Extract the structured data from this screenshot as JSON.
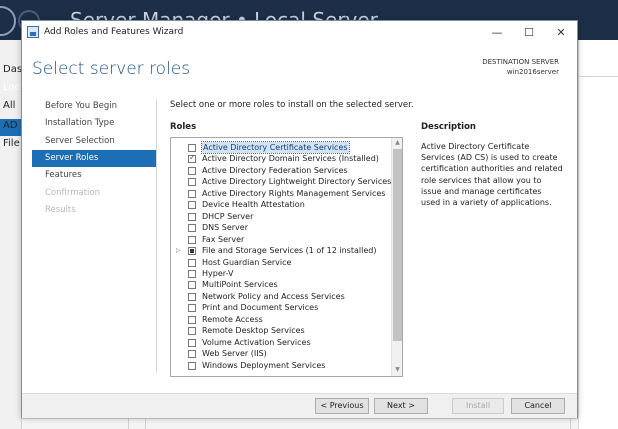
{
  "background": {
    "title": "Server Manager • Local Server",
    "nav_items": [
      "Das",
      "Loc",
      "All",
      "AD",
      "File"
    ]
  },
  "dialog": {
    "title": "Add Roles and Features Wizard",
    "window_buttons": {
      "minimize": "—",
      "maximize": "☐",
      "close": "✕"
    }
  },
  "header": {
    "page_title": "Select server roles",
    "destination_label": "DESTINATION SERVER",
    "destination_server": "win2016server"
  },
  "nav": {
    "items": [
      {
        "label": "Before You Begin",
        "state": "normal"
      },
      {
        "label": "Installation Type",
        "state": "normal"
      },
      {
        "label": "Server Selection",
        "state": "normal"
      },
      {
        "label": "Server Roles",
        "state": "selected"
      },
      {
        "label": "Features",
        "state": "normal"
      },
      {
        "label": "Confirmation",
        "state": "disabled"
      },
      {
        "label": "Results",
        "state": "disabled"
      }
    ]
  },
  "content": {
    "instruction": "Select one or more roles to install on the selected server.",
    "roles_label": "Roles",
    "description_label": "Description",
    "description_text": "Active Directory Certificate Services (AD CS) is used to create certification authorities and related role services that allow you to issue and manage certificates used in a variety of applications."
  },
  "roles": [
    {
      "label": "Active Directory Certificate Services",
      "state": "unchecked",
      "selected": true,
      "expander": false
    },
    {
      "label": "Active Directory Domain Services (Installed)",
      "state": "checked",
      "selected": false,
      "expander": false
    },
    {
      "label": "Active Directory Federation Services",
      "state": "unchecked",
      "selected": false,
      "expander": false
    },
    {
      "label": "Active Directory Lightweight Directory Services",
      "state": "unchecked",
      "selected": false,
      "expander": false
    },
    {
      "label": "Active Directory Rights Management Services",
      "state": "unchecked",
      "selected": false,
      "expander": false
    },
    {
      "label": "Device Health Attestation",
      "state": "unchecked",
      "selected": false,
      "expander": false
    },
    {
      "label": "DHCP Server",
      "state": "unchecked",
      "selected": false,
      "expander": false
    },
    {
      "label": "DNS Server",
      "state": "unchecked",
      "selected": false,
      "expander": false
    },
    {
      "label": "Fax Server",
      "state": "unchecked",
      "selected": false,
      "expander": false
    },
    {
      "label": "File and Storage Services (1 of 12 installed)",
      "state": "partial",
      "selected": false,
      "expander": true
    },
    {
      "label": "Host Guardian Service",
      "state": "unchecked",
      "selected": false,
      "expander": false
    },
    {
      "label": "Hyper-V",
      "state": "unchecked",
      "selected": false,
      "expander": false
    },
    {
      "label": "MultiPoint Services",
      "state": "unchecked",
      "selected": false,
      "expander": false
    },
    {
      "label": "Network Policy and Access Services",
      "state": "unchecked",
      "selected": false,
      "expander": false
    },
    {
      "label": "Print and Document Services",
      "state": "unchecked",
      "selected": false,
      "expander": false
    },
    {
      "label": "Remote Access",
      "state": "unchecked",
      "selected": false,
      "expander": false
    },
    {
      "label": "Remote Desktop Services",
      "state": "unchecked",
      "selected": false,
      "expander": false
    },
    {
      "label": "Volume Activation Services",
      "state": "unchecked",
      "selected": false,
      "expander": false
    },
    {
      "label": "Web Server (IIS)",
      "state": "unchecked",
      "selected": false,
      "expander": false
    },
    {
      "label": "Windows Deployment Services",
      "state": "unchecked",
      "selected": false,
      "expander": false
    }
  ],
  "footer": {
    "previous_label": "< Previous",
    "next_label": "Next >",
    "install_label": "Install",
    "cancel_label": "Cancel"
  },
  "colors": {
    "accent": "#1c6fb5",
    "title_blue": "#1c4f86",
    "bg_titlebar": "#1d2e48"
  }
}
